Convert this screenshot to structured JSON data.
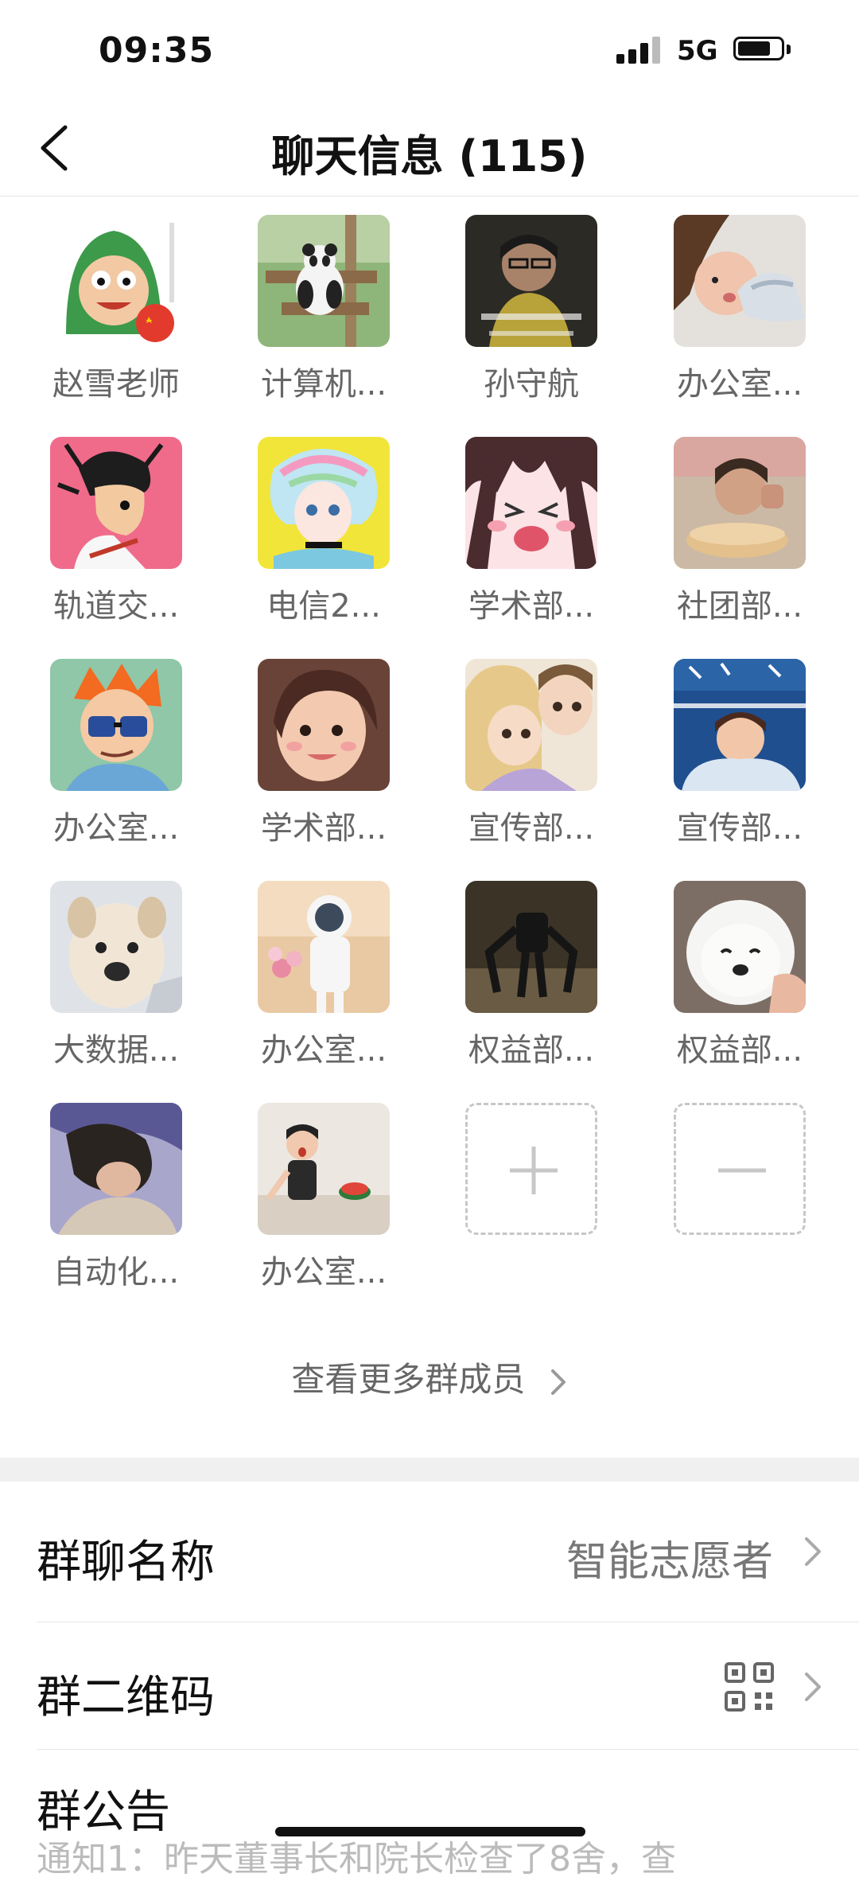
{
  "status": {
    "time": "09:35",
    "network": "5G"
  },
  "nav": {
    "title": "聊天信息 (115)"
  },
  "members": [
    {
      "name": "赵雪老师"
    },
    {
      "name": "计算机..."
    },
    {
      "name": "孙守航"
    },
    {
      "name": "办公室..."
    },
    {
      "name": "轨道交..."
    },
    {
      "name": "电信2..."
    },
    {
      "name": "学术部..."
    },
    {
      "name": "社团部..."
    },
    {
      "name": "办公室..."
    },
    {
      "name": "学术部..."
    },
    {
      "name": "宣传部..."
    },
    {
      "name": "宣传部..."
    },
    {
      "name": "大数据..."
    },
    {
      "name": "办公室..."
    },
    {
      "name": "权益部..."
    },
    {
      "name": "权益部..."
    },
    {
      "name": "自动化..."
    },
    {
      "name": "办公室..."
    }
  ],
  "more_members": "查看更多群成员",
  "settings": {
    "group_name_label": "群聊名称",
    "group_name_value": "智能志愿者",
    "qr_label": "群二维码",
    "announcement_label": "群公告",
    "announcement_preview": "通知1：昨天董事长和院长检查了8舍，查"
  },
  "icons": {
    "back": "back-arrow-icon",
    "add": "plus-icon",
    "remove": "minus-icon",
    "chevron": "chevron-right-icon",
    "qr": "qr-code-icon"
  }
}
